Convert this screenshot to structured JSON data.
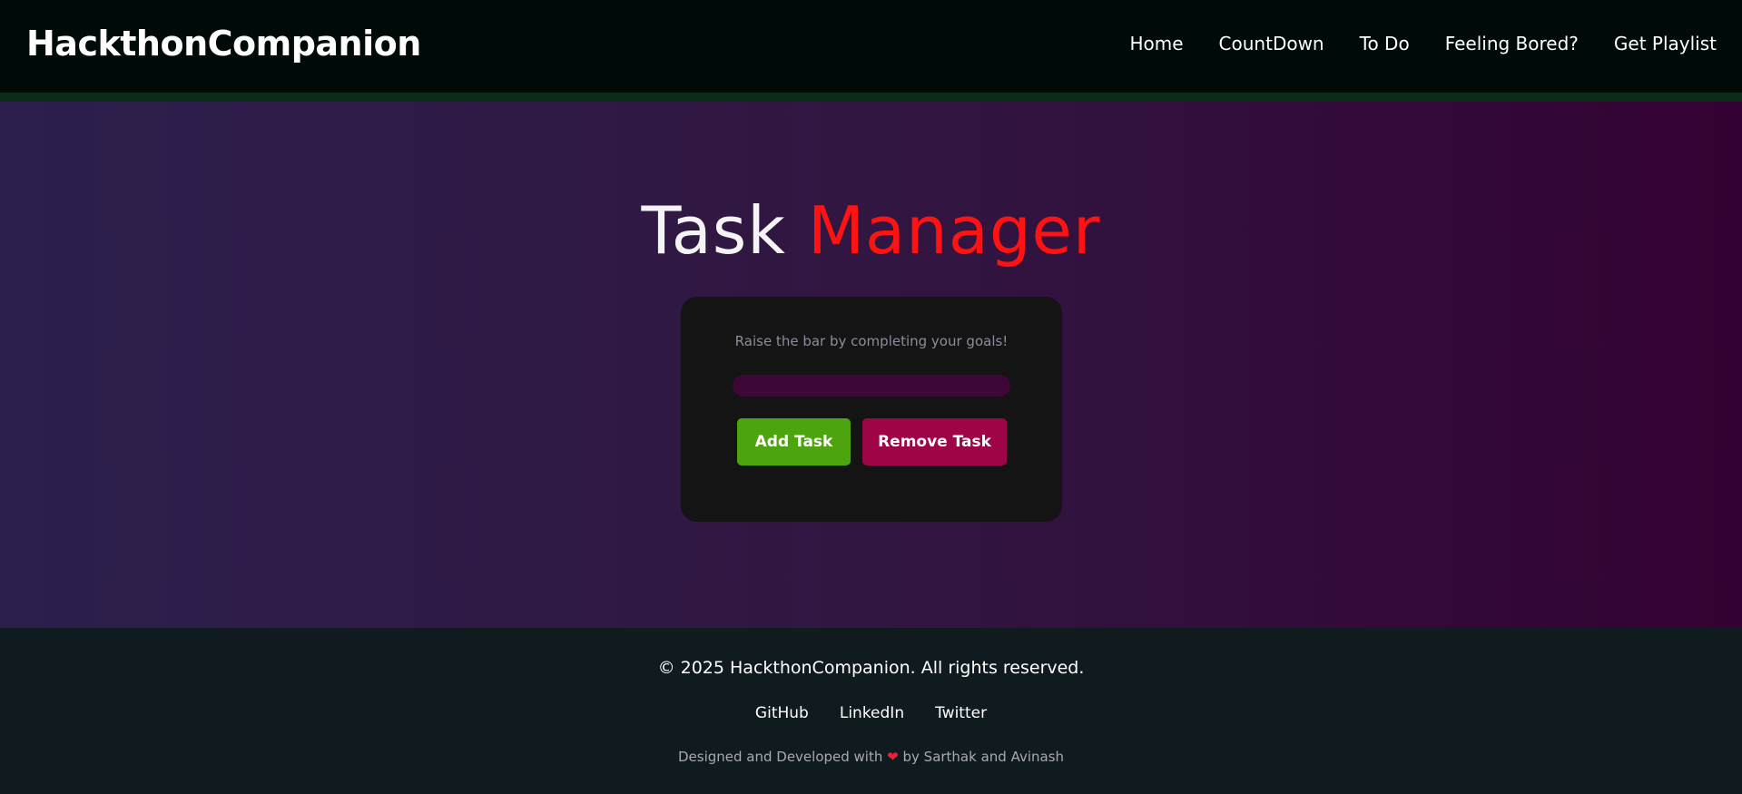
{
  "brand": "HackthonCompanion",
  "nav": {
    "items": [
      {
        "label": "Home"
      },
      {
        "label": "CountDown"
      },
      {
        "label": "To Do"
      },
      {
        "label": "Feeling Bored?"
      },
      {
        "label": "Get Playlist"
      }
    ]
  },
  "hero": {
    "title_part1": "Task",
    "title_part2": "Manager",
    "subtitle": "Raise the bar by completing your goals!",
    "progress": 0,
    "add_label": "Add Task",
    "remove_label": "Remove Task"
  },
  "footer": {
    "copyright": "© 2025 HackthonCompanion. All rights reserved.",
    "links": [
      {
        "label": "GitHub"
      },
      {
        "label": "LinkedIn"
      },
      {
        "label": "Twitter"
      }
    ],
    "credit_prefix": "Designed and Developed with",
    "credit_icon": "heart-icon",
    "credit_suffix": "by Sarthak and Avinash"
  },
  "colors": {
    "accent_green": "#4ea40e",
    "accent_red": "#ff1212",
    "remove_button": "#9e0546",
    "progress_track": "#3d0737"
  }
}
